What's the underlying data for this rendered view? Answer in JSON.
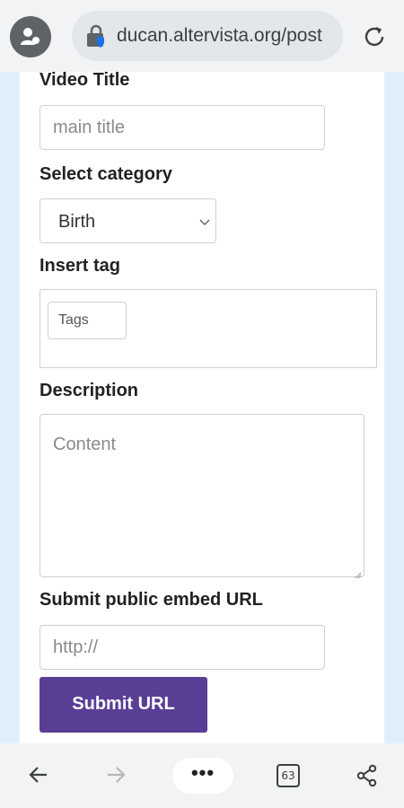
{
  "browser": {
    "url": "ducan.altervista.org/post",
    "tab_count": "63",
    "more_label": "•••",
    "icons": [
      "profile-icon",
      "lock-icon",
      "reload-icon",
      "back-icon",
      "forward-icon",
      "share-icon"
    ]
  },
  "form": {
    "video_title": {
      "label": "Video Title",
      "placeholder": "main title"
    },
    "category": {
      "label": "Select category",
      "value": "Birth"
    },
    "tag": {
      "label": "Insert tag",
      "placeholder": "Tags"
    },
    "description": {
      "label": "Description",
      "placeholder": "Content"
    },
    "embed": {
      "label": "Submit public embed URL",
      "placeholder": "http://"
    },
    "submit_label": "Submit URL"
  },
  "colors": {
    "button": "#5a3e95",
    "page_background": "#dfeefb",
    "browser_chrome": "#f1f3f4"
  }
}
